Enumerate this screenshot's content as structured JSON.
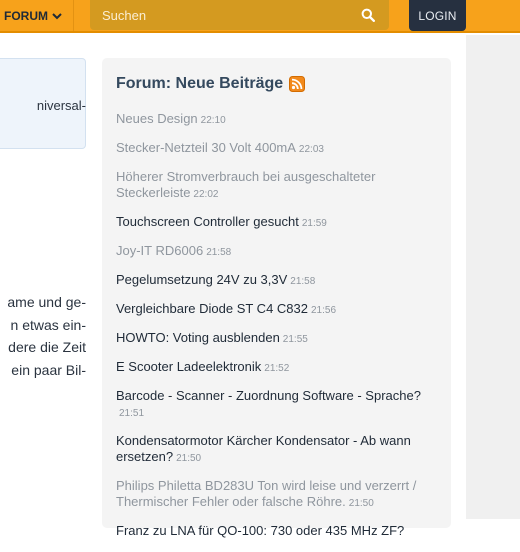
{
  "header": {
    "forum_label": "FORUM",
    "search_placeholder": "Suchen",
    "login_label": "LOGIN"
  },
  "left_column": {
    "box_text": "niversal-",
    "body_lines": [
      "ame und ge-",
      "n etwas ein-",
      "dere die Zeit",
      "ein paar Bil-"
    ]
  },
  "panel": {
    "title": "Forum: Neue Beiträge",
    "posts": [
      {
        "title": "Neues Design",
        "time": "22:10",
        "read": true
      },
      {
        "title": "Stecker-Netzteil 30 Volt 400mA",
        "time": "22:03",
        "read": true
      },
      {
        "title": "Höherer Stromverbrauch bei ausgeschalteter Steckerleiste",
        "time": "22:02",
        "read": true
      },
      {
        "title": "Touchscreen Controller gesucht",
        "time": "21:59",
        "read": false
      },
      {
        "title": "Joy-IT RD6006",
        "time": "21:58",
        "read": true
      },
      {
        "title": "Pegelumsetzung 24V zu 3,3V",
        "time": "21:58",
        "read": false
      },
      {
        "title": "Vergleichbare Diode ST C4 C832",
        "time": "21:56",
        "read": false
      },
      {
        "title": "HOWTO: Voting ausblenden",
        "time": "21:55",
        "read": false
      },
      {
        "title": "E Scooter Ladeelektronik",
        "time": "21:52",
        "read": false
      },
      {
        "title": "Barcode - Scanner - Zuordnung Software - Sprache?",
        "time": "21:51",
        "read": false
      },
      {
        "title": "Kondensatormotor Kärcher Kondensator - Ab wann ersetzen?",
        "time": "21:50",
        "read": false
      },
      {
        "title": "Philips Philetta BD283U Ton wird leise und verzerrt / Thermischer Fehler oder falsche Röhre.",
        "time": "21:50",
        "read": true
      },
      {
        "title": "Franz zu LNA für QO-100: 730 oder 435 MHz ZF?",
        "time": "",
        "read": false
      }
    ]
  },
  "colors": {
    "header_bg": "#f7a21b",
    "search_bg": "#d49a20",
    "login_bg": "#263040",
    "panel_bg": "#f4f4f4",
    "link": "#1f2a37",
    "visited": "#8f969e"
  }
}
